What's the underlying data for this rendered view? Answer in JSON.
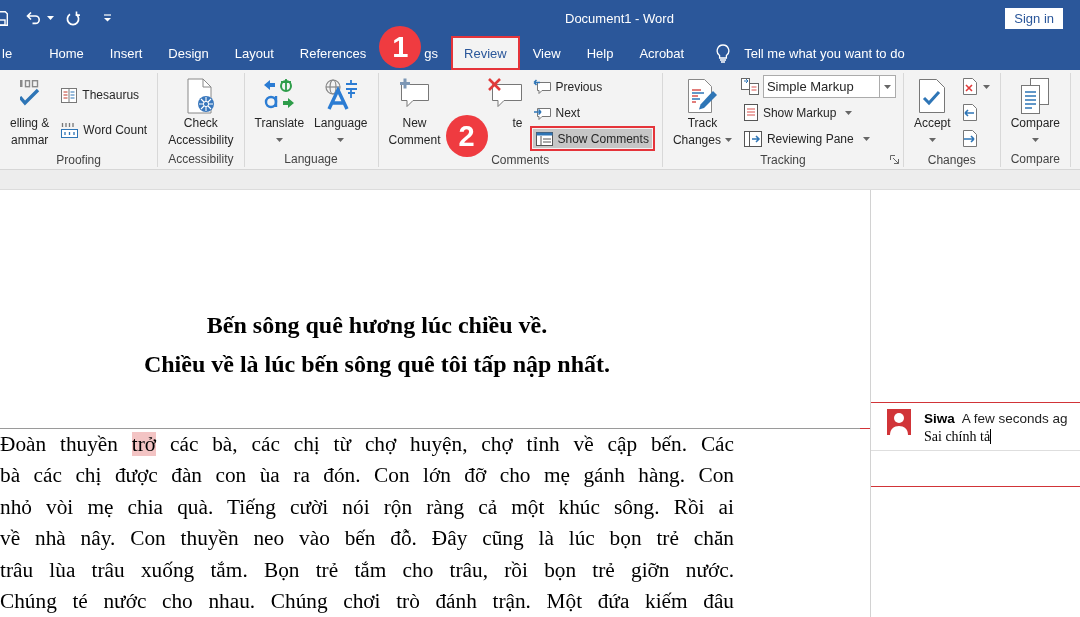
{
  "title_bar": {
    "title": "Document1 - Word",
    "sign_in": "Sign in"
  },
  "tabs": [
    {
      "label": "le",
      "selected": false,
      "highlighted": false
    },
    {
      "label": "Home",
      "selected": false,
      "highlighted": false
    },
    {
      "label": "Insert",
      "selected": false,
      "highlighted": false
    },
    {
      "label": "Design",
      "selected": false,
      "highlighted": false
    },
    {
      "label": "Layout",
      "selected": false,
      "highlighted": false
    },
    {
      "label": "References",
      "selected": false,
      "highlighted": false
    },
    {
      "label": "gs",
      "selected": false,
      "highlighted": false,
      "marker": "1"
    },
    {
      "label": "Review",
      "selected": true,
      "highlighted": true
    },
    {
      "label": "View",
      "selected": false,
      "highlighted": false
    },
    {
      "label": "Help",
      "selected": false,
      "highlighted": false
    },
    {
      "label": "Acrobat",
      "selected": false,
      "highlighted": false
    }
  ],
  "tell_me": {
    "placeholder": "Tell me what you want to do"
  },
  "ribbon": [
    {
      "label": "Proofing",
      "launcher": false,
      "items": [
        {
          "kind": "large",
          "lines": [
            "elling &",
            "ammar"
          ],
          "dropdown": false
        },
        {
          "kind": "small",
          "label": "Thesaurus",
          "dropdown": false,
          "on": false,
          "highlighted": false
        },
        {
          "kind": "small",
          "label": "Word Count",
          "dropdown": false,
          "on": false,
          "highlighted": false
        }
      ]
    },
    {
      "label": "Accessibility",
      "launcher": false,
      "items": [
        {
          "kind": "large",
          "lines": [
            "Check",
            "Accessibility"
          ],
          "dropdown": false
        }
      ]
    },
    {
      "label": "Language",
      "launcher": false,
      "items": [
        {
          "kind": "large",
          "lines": [
            "Translate"
          ],
          "dropdown": true
        },
        {
          "kind": "large",
          "lines": [
            "Language"
          ],
          "dropdown": true
        }
      ]
    },
    {
      "label": "Comments",
      "launcher": false,
      "items": [
        {
          "kind": "large",
          "lines": [
            "New",
            "Comment"
          ],
          "dropdown": false
        },
        {
          "kind": "large",
          "lines": [
            "te"
          ],
          "dropdown": false,
          "marker": "2"
        },
        {
          "kind": "small",
          "label": "Previous",
          "dropdown": false,
          "on": false,
          "highlighted": false
        },
        {
          "kind": "small",
          "label": "Next",
          "dropdown": false,
          "on": false,
          "highlighted": false
        },
        {
          "kind": "small",
          "label": "Show Comments",
          "dropdown": false,
          "on": true,
          "highlighted": true
        }
      ]
    },
    {
      "label": "Tracking",
      "launcher": true,
      "items": [
        {
          "kind": "large",
          "lines": [
            "Track",
            "Changes"
          ],
          "dropdown": true
        },
        {
          "kind": "select",
          "value": "Simple Markup"
        },
        {
          "kind": "small",
          "label": "Show Markup",
          "dropdown": true,
          "on": false,
          "highlighted": false
        },
        {
          "kind": "small",
          "label": "Reviewing Pane",
          "dropdown": true,
          "on": false,
          "highlighted": false
        }
      ]
    },
    {
      "label": "Changes",
      "launcher": false,
      "items": [
        {
          "kind": "large",
          "lines": [
            "Accept"
          ],
          "dropdown": true
        },
        {
          "kind": "small",
          "dropdown": true,
          "on": false,
          "highlighted": false
        },
        {
          "kind": "small",
          "dropdown": false,
          "on": false,
          "highlighted": false
        },
        {
          "kind": "small",
          "dropdown": false,
          "on": false,
          "highlighted": false
        }
      ]
    },
    {
      "label": "Compare",
      "launcher": false,
      "items": [
        {
          "kind": "large",
          "lines": [
            "Compare"
          ],
          "dropdown": true
        }
      ]
    }
  ],
  "document": {
    "heading": [
      "Bến sông quê hương lúc chiều về.",
      "Chiều về là lúc bến sông quê tôi tấp nập nhất."
    ],
    "lines": [
      [
        {
          "kind": "text",
          "text": "Đoàn thuyền "
        },
        {
          "kind": "comment_anchor",
          "text": "trở"
        },
        {
          "kind": "text",
          "text": " các bà, các chị từ chợ huyện, chợ tỉnh về cập bến. Các"
        }
      ],
      [
        {
          "kind": "text",
          "text": "bà các chị được đàn con ùa ra đón. Con lớn đỡ cho mẹ gánh hàng. Con"
        }
      ],
      [
        {
          "kind": "text",
          "text": "nhỏ vòi mẹ chia quà. Tiếng cười nói rộn ràng cả một khúc sông. Rồi ai"
        }
      ],
      [
        {
          "kind": "text",
          "text": "về nhà nây. Con thuyền neo vào bến đỗ. Đây cũng là lúc bọn trẻ chăn"
        }
      ],
      [
        {
          "kind": "text",
          "text": "trâu lùa trâu xuống tắm. Bọn trẻ tắm cho trâu, rồi bọn trẻ giỡn nước."
        }
      ],
      [
        {
          "kind": "text",
          "text": "Chúng té nước cho nhau. Chúng chơi trò đánh trận. Một đứa kiếm đâu"
        }
      ]
    ]
  },
  "comments": [
    {
      "author": "Siwa",
      "time": "A few seconds ag",
      "text": "Sai chính tả",
      "editing": true
    }
  ]
}
